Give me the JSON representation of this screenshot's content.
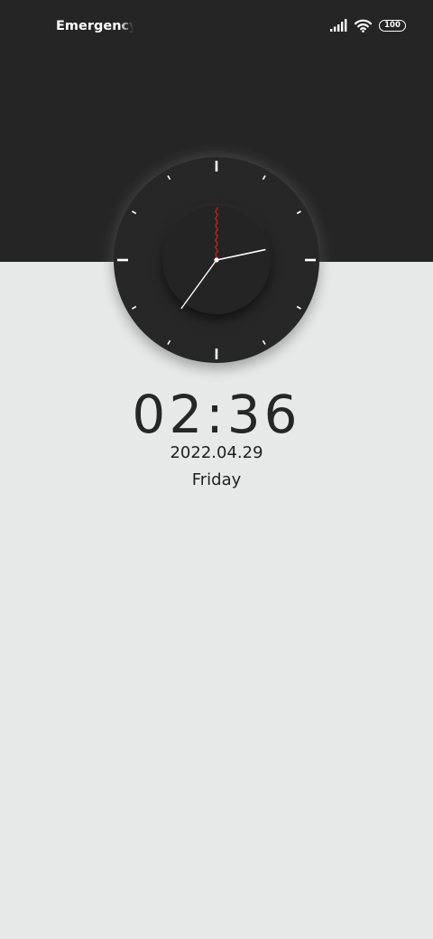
{
  "status_bar": {
    "carrier_text": "Emergency calls only",
    "signal_icon": "cellular-signal-icon",
    "wifi_icon": "wifi-icon",
    "battery_level": "100"
  },
  "clock": {
    "hour": 2,
    "minute": 36,
    "second": 0,
    "second_hand_color": "#c0201c",
    "hand_color": "#ffffff"
  },
  "lock_screen": {
    "time": "02:36",
    "date": "2022.04.29",
    "weekday": "Friday"
  },
  "colors": {
    "top_panel": "#252525",
    "background": "#e7e9e8",
    "text": "#262626"
  }
}
